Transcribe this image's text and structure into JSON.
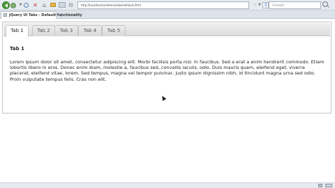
{
  "browser": {
    "url": "http://localhost/ui/demos/tabs/default.html",
    "search_placeholder": "Google",
    "tab_title": "jQuery UI Tabs - Default functionality",
    "new_tab_label": "+"
  },
  "icons": {
    "back": "back-arrow-icon",
    "forward": "forward-arrow-icon",
    "reload": "reload-icon",
    "stop": "stop-icon",
    "home": "home-icon",
    "bookmark": "star-icon",
    "search": "magnifier-icon"
  },
  "tabs": [
    {
      "label": "Tab 1",
      "active": true
    },
    {
      "label": "Tab 2",
      "active": false
    },
    {
      "label": "Tab 3",
      "active": false
    },
    {
      "label": "Tab 4",
      "active": false
    },
    {
      "label": "Tab 5",
      "active": false
    }
  ],
  "panel": {
    "heading": "Tab 1",
    "text": "Lorem ipsum dolor sit amet, consectetur adipiscing elit. Morbi facilisis porta nisl. In faucibus. Sed a erat a enim hendrerit commodo. Etiam lobortis libero in eros. Donec enim diam, molestie a, faucibus sed, convallis iaculis, odio. Duis mauris quam, eleifend eget, viverra placerat, eleifend vitae, lorem. Sed tempus, magna vel tempor pulvinar, justo ipsum dignissim nibh, id tincidunt magna urna sed odio. Proin vulputate tempus felis. Cras non elit."
  },
  "colors": {
    "active_tab": "#ffffff",
    "inactive_tab": "#dcdcdc",
    "border": "#c4c4c4",
    "text": "#222222"
  }
}
